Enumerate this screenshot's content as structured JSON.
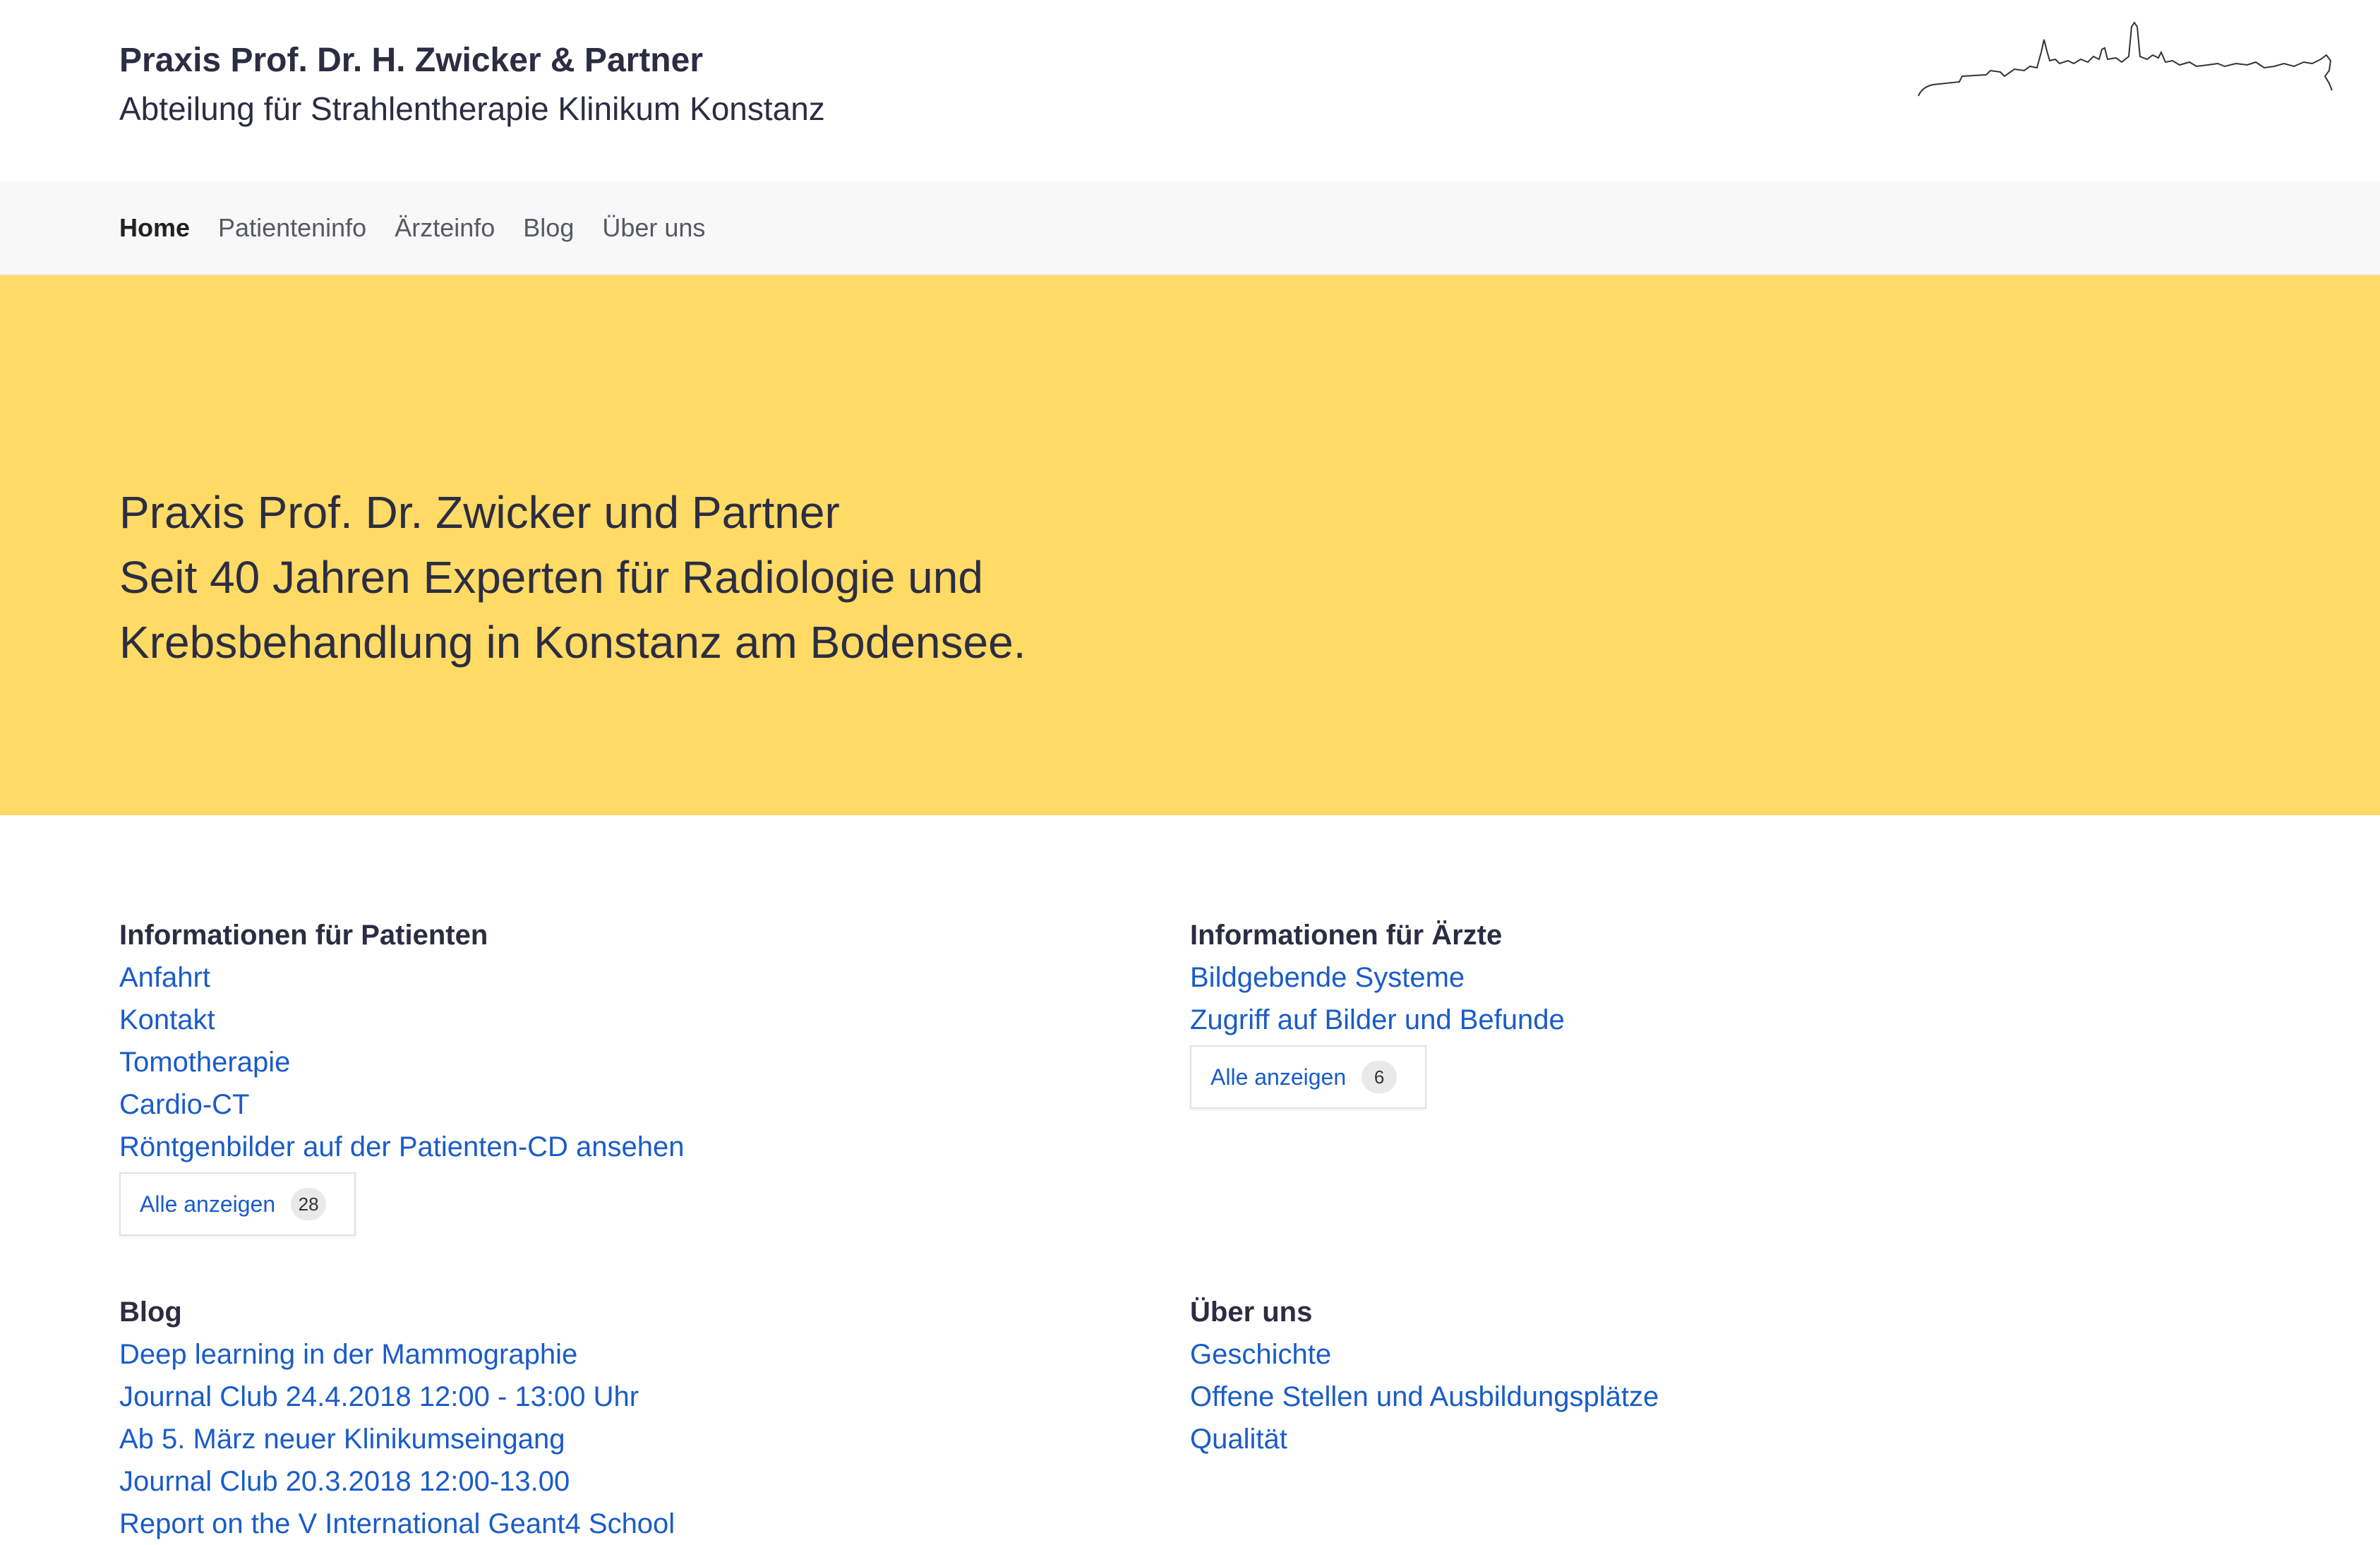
{
  "header": {
    "title": "Praxis Prof. Dr. H. Zwicker & Partner",
    "subtitle": "Abteilung für Strahlentherapie Klinikum Konstanz",
    "logo_icon": "konstanz-skyline-icon"
  },
  "nav": {
    "items": [
      {
        "label": "Home",
        "active": true
      },
      {
        "label": "Patienteninfo",
        "active": false
      },
      {
        "label": "Ärzteinfo",
        "active": false
      },
      {
        "label": "Blog",
        "active": false
      },
      {
        "label": "Über uns",
        "active": false
      }
    ]
  },
  "hero": {
    "lines": [
      "Praxis Prof. Dr. Zwicker und Partner",
      "Seit 40 Jahren Experten für Radiologie und",
      "Krebsbehandlung in Konstanz am Bodensee."
    ],
    "background": "#ffda65"
  },
  "sections": {
    "patients": {
      "title": "Informationen für Patienten",
      "links": [
        "Anfahrt",
        "Kontakt",
        "Tomotherapie",
        "Cardio-CT",
        "Röntgenbilder auf der Patienten-CD ansehen"
      ],
      "show_all": {
        "label": "Alle anzeigen",
        "count": "28"
      }
    },
    "doctors": {
      "title": "Informationen für Ärzte",
      "links": [
        "Bildgebende Systeme",
        "Zugriff auf Bilder und Befunde"
      ],
      "show_all": {
        "label": "Alle anzeigen",
        "count": "6"
      }
    },
    "blog": {
      "title": "Blog",
      "links": [
        "Deep learning in der Mammographie",
        "Journal Club 24.4.2018 12:00 - 13:00 Uhr",
        "Ab 5. März neuer Klinikumseingang",
        "Journal Club 20.3.2018 12:00-13.00",
        "Report on the V International Geant4 School"
      ]
    },
    "about": {
      "title": "Über uns",
      "links": [
        "Geschichte",
        "Offene Stellen und Ausbildungsplätze",
        "Qualität"
      ]
    }
  },
  "colors": {
    "link": "#1a5cc8",
    "text": "#2b2d42",
    "hero": "#ffda65"
  }
}
